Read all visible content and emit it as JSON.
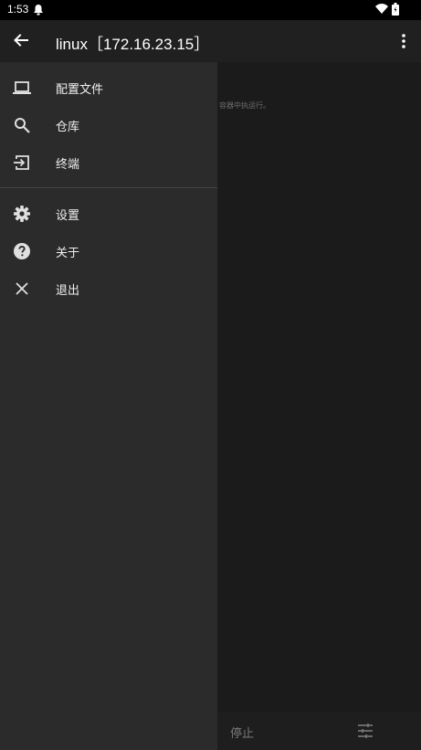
{
  "status_bar": {
    "time": "1:53",
    "notification_icon": "notification-icon",
    "wifi_icon": "wifi-icon",
    "battery_icon": "battery-icon"
  },
  "app_bar": {
    "title": "linux［172.16.23.15］",
    "back_icon": "back-arrow-icon",
    "overflow_icon": "more-vert-icon"
  },
  "drawer": {
    "items": [
      {
        "label": "配置文件",
        "icon": "laptop-icon"
      },
      {
        "label": "仓库",
        "icon": "search-icon"
      },
      {
        "label": "终端",
        "icon": "exit-to-app-icon"
      },
      {
        "label": "设置",
        "icon": "gear-icon"
      },
      {
        "label": "关于",
        "icon": "help-icon"
      },
      {
        "label": "退出",
        "icon": "close-icon"
      }
    ]
  },
  "background": {
    "hint_text": "容器中执运行。",
    "stop_label": "停止",
    "tune_icon": "tune-icon"
  }
}
